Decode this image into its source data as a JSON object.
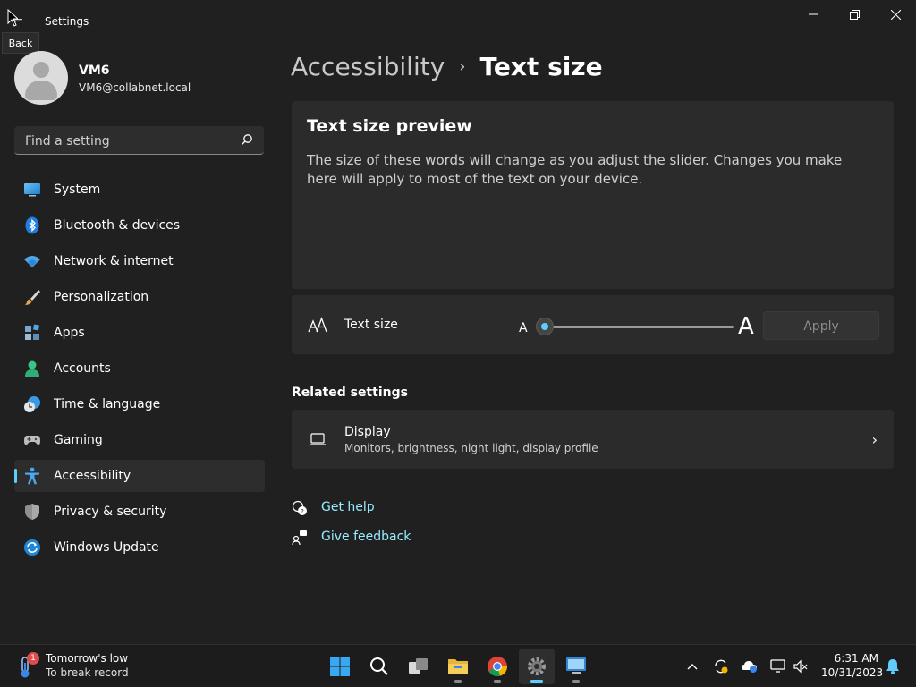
{
  "window": {
    "title": "Settings",
    "back_tooltip": "Back",
    "controls": [
      "minimize",
      "restore",
      "close"
    ]
  },
  "profile": {
    "name": "VM6",
    "email": "VM6@collabnet.local"
  },
  "search": {
    "placeholder": "Find a setting"
  },
  "nav": {
    "items": [
      {
        "label": "System",
        "icon": "system-icon"
      },
      {
        "label": "Bluetooth & devices",
        "icon": "bluetooth-icon"
      },
      {
        "label": "Network & internet",
        "icon": "wifi-icon"
      },
      {
        "label": "Personalization",
        "icon": "brush-icon"
      },
      {
        "label": "Apps",
        "icon": "apps-icon"
      },
      {
        "label": "Accounts",
        "icon": "accounts-icon"
      },
      {
        "label": "Time & language",
        "icon": "time-language-icon"
      },
      {
        "label": "Gaming",
        "icon": "gamepad-icon"
      },
      {
        "label": "Accessibility",
        "icon": "accessibility-icon",
        "active": true
      },
      {
        "label": "Privacy & security",
        "icon": "shield-icon"
      },
      {
        "label": "Windows Update",
        "icon": "windows-update-icon"
      }
    ]
  },
  "breadcrumb": {
    "parent": "Accessibility",
    "separator": "›",
    "current": "Text size"
  },
  "preview": {
    "title": "Text size preview",
    "body": "The size of these words will change as you adjust the slider. Changes you make here will apply to most of the text on your device."
  },
  "text_size": {
    "label": "Text size",
    "small_glyph": "A",
    "large_glyph": "A",
    "slider_value_percent": 0,
    "apply_label": "Apply"
  },
  "related": {
    "heading": "Related settings",
    "display_title": "Display",
    "display_subtitle": "Monitors, brightness, night light, display profile"
  },
  "help": {
    "get_help": "Get help",
    "give_feedback": "Give feedback"
  },
  "taskbar": {
    "weather_line1": "Tomorrow's low",
    "weather_line2": "To break record",
    "weather_badge": "1",
    "time": "6:31 AM",
    "date": "10/31/2023"
  },
  "colors": {
    "accent": "#60cdff",
    "link": "#99ebff",
    "background": "#202020",
    "card": "#2b2b2b"
  }
}
